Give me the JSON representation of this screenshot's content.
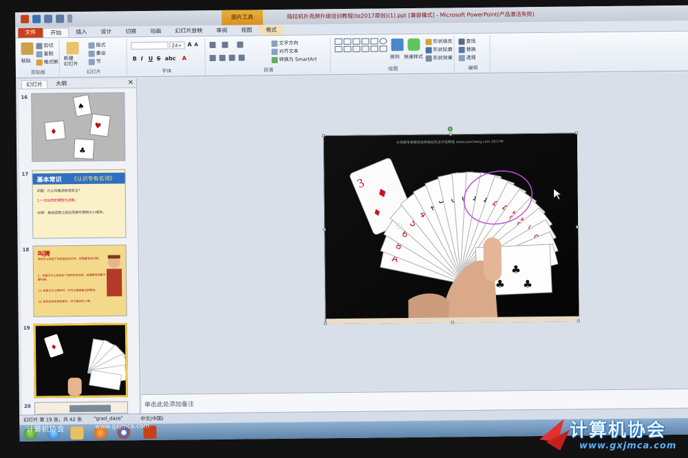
{
  "app": {
    "doc_title": "指拉机扑克牌升级培训教程(te2017原创)(1).ppt [兼容模式] - Microsoft PowerPoint(产品激活失败)",
    "context_tool": "图片工具"
  },
  "tabs": [
    "文件",
    "开始",
    "插入",
    "设计",
    "切换",
    "动画",
    "幻灯片放映",
    "审阅",
    "视图",
    "格式"
  ],
  "ribbon": {
    "clipboard": {
      "label": "剪贴板",
      "paste": "粘贴",
      "cut": "剪切",
      "copy": "复制",
      "format_painter": "格式刷"
    },
    "slides": {
      "label": "幻灯片",
      "new_slide": "新建\n幻灯片",
      "layout": "版式",
      "reset": "重设",
      "section": "节"
    },
    "font": {
      "label": "字体",
      "font_size": "24+"
    },
    "paragraph": {
      "label": "段落",
      "text_direction": "文字方向",
      "align_text": "对齐文本",
      "smartart": "转换为 SmartArt"
    },
    "drawing": {
      "label": "绘图",
      "arrange": "排列",
      "quick_styles": "快速样式",
      "shape_fill": "形状填充",
      "shape_outline": "形状轮廓",
      "shape_effects": "形状效果"
    },
    "editing": {
      "label": "编辑",
      "find": "查找",
      "replace": "替换",
      "select": "选择"
    }
  },
  "pane": {
    "tabs": [
      "幻灯片",
      "大纲"
    ],
    "slides": [
      {
        "num": "16"
      },
      {
        "num": "17",
        "title": "基本常识",
        "subtitle": "《认识专有名词》",
        "lines": [
          "问题：什么叫做流板或双王？",
          "1.一次出完的牌型为流板。",
          "分牌：指在底牌之前出完牌可按照大小顺序。"
        ]
      },
      {
        "num": "18",
        "title": "叫牌",
        "lines": [
          "当你手上抓到了当前选定的主时，就需要考虑叫牌。",
          "2、当自己手上有有多个相同花色的时，就需要考虑要不要叫牌。",
          "(1) 当自己手上牌多时，又可以提高自己的胜率。",
          "(2) 当你还有总体较差时，对于最多的人情。"
        ]
      },
      {
        "num": "19"
      },
      {
        "num": "20"
      }
    ]
  },
  "slide": {
    "caption": "扑克牌专家教你玩转指拉机主升级教程 www.jiaocheng.com 2017年"
  },
  "notes": {
    "placeholder": "单击此处添加备注"
  },
  "status": {
    "slide_info": "幻灯片 第 19 张，共 42 张",
    "theme": "\"grad_daze\"",
    "language": "中文(中国)"
  },
  "watermark": {
    "title": "计算机协会",
    "url": "www.gxjmca.com",
    "left_text": "计算机协会",
    "left_url": "www.gxjmca.com"
  }
}
